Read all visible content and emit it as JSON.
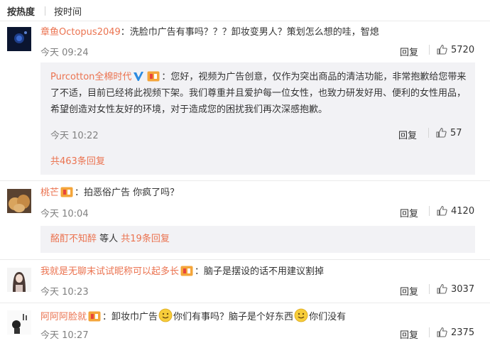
{
  "sort": {
    "hot": "按热度",
    "time": "按时间"
  },
  "comments": [
    {
      "user": "章鱼Octopus2049",
      "sep": "：",
      "text": "洗脸巾广告有事吗？？？卸妆变男人？策划怎么想的哇，智熄",
      "time": "今天 09:24",
      "reply": "回复",
      "likes": "5720"
    },
    {
      "user": "桃芒",
      "sep": "：",
      "text": "拍恶俗广告 你疯了吗？",
      "time": "今天 10:04",
      "reply": "回复",
      "likes": "4120"
    },
    {
      "user": "我就是无聊末试试昵称可以起多长",
      "sep": "：",
      "text": "脑子是摆设的话不用建议割掉",
      "time": "今天 10:23",
      "reply": "回复",
      "likes": "3037"
    },
    {
      "user": "阿阿阿脸就",
      "sep": "：",
      "text_a": "卸妆巾广告",
      "text_b": "你们有事吗？脑子是个好东西",
      "text_c": "你们没有",
      "time": "今天 10:27",
      "reply": "回复",
      "likes": "2375"
    }
  ],
  "sub_reply": {
    "user": "Purcotton全棉时代",
    "sep": "：",
    "text": "您好，视频为广告创意，仅作为突出商品的清洁功能，非常抱歉给您带来了不适，目前已经将此视频下架。我们尊重并且爱护每一位女性，也致力研发好用、便利的女性用品，希望创造对女性友好的环境，对于造成您的困扰我们再次深感抱歉。",
    "time": "今天 10:22",
    "reply": "回复",
    "likes": "57",
    "total": "共463条回复"
  },
  "reply_summary_2": {
    "user": "酩酊不知醉",
    "middle": " 等人 ",
    "total": "共19条回复"
  },
  "colors": {
    "accent": "#eb7350",
    "reply_bg": "#f2f2f5",
    "muted": "#808080"
  }
}
